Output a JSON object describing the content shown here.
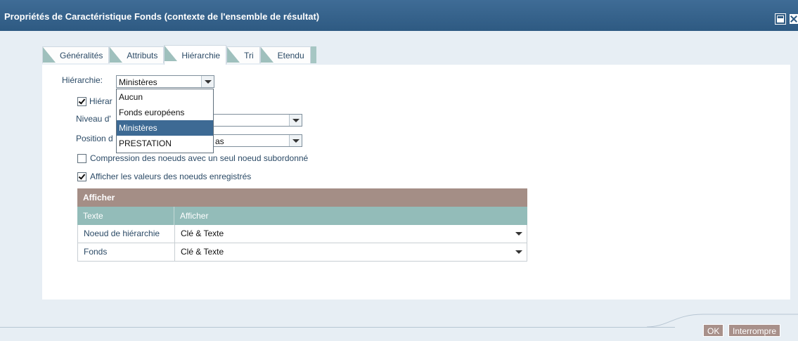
{
  "window": {
    "title": "Propriétés de Caractéristique Fonds (contexte de l'ensemble de résultat)"
  },
  "tabs": [
    {
      "label": "Généralités"
    },
    {
      "label": "Attributs"
    },
    {
      "label": "Hiérarchie"
    },
    {
      "label": "Tri"
    },
    {
      "label": "Etendu"
    }
  ],
  "form": {
    "hierarchy_label": "Hiérarchie:",
    "hierarchy_value": "Ministères",
    "hierarchy_checkbox_label": "Hiérar",
    "level_label": "Niveau d'",
    "position_label": "Position d",
    "position_value": "as",
    "compress_label": "Compression des noeuds avec un seul noeud subordonné",
    "show_values_label": "Afficher les valeurs des noeuds enregistrés"
  },
  "dropdown": {
    "options": [
      "Aucun",
      "Fonds européens",
      "Ministères",
      "PRESTATION"
    ],
    "selected": "Ministères"
  },
  "table": {
    "title": "Afficher",
    "columns": [
      "Texte",
      "Afficher"
    ],
    "rows": [
      {
        "text": "Noeud de hiérarchie",
        "display": "Clé & Texte"
      },
      {
        "text": "Fonds",
        "display": "Clé & Texte"
      }
    ]
  },
  "buttons": {
    "ok": "OK",
    "cancel": "Interrompre"
  },
  "colors": {
    "titlebar": "#2e5a82",
    "selection": "#3d6a94",
    "table_header": "#a48e86",
    "table_columns": "#93bcb9"
  }
}
